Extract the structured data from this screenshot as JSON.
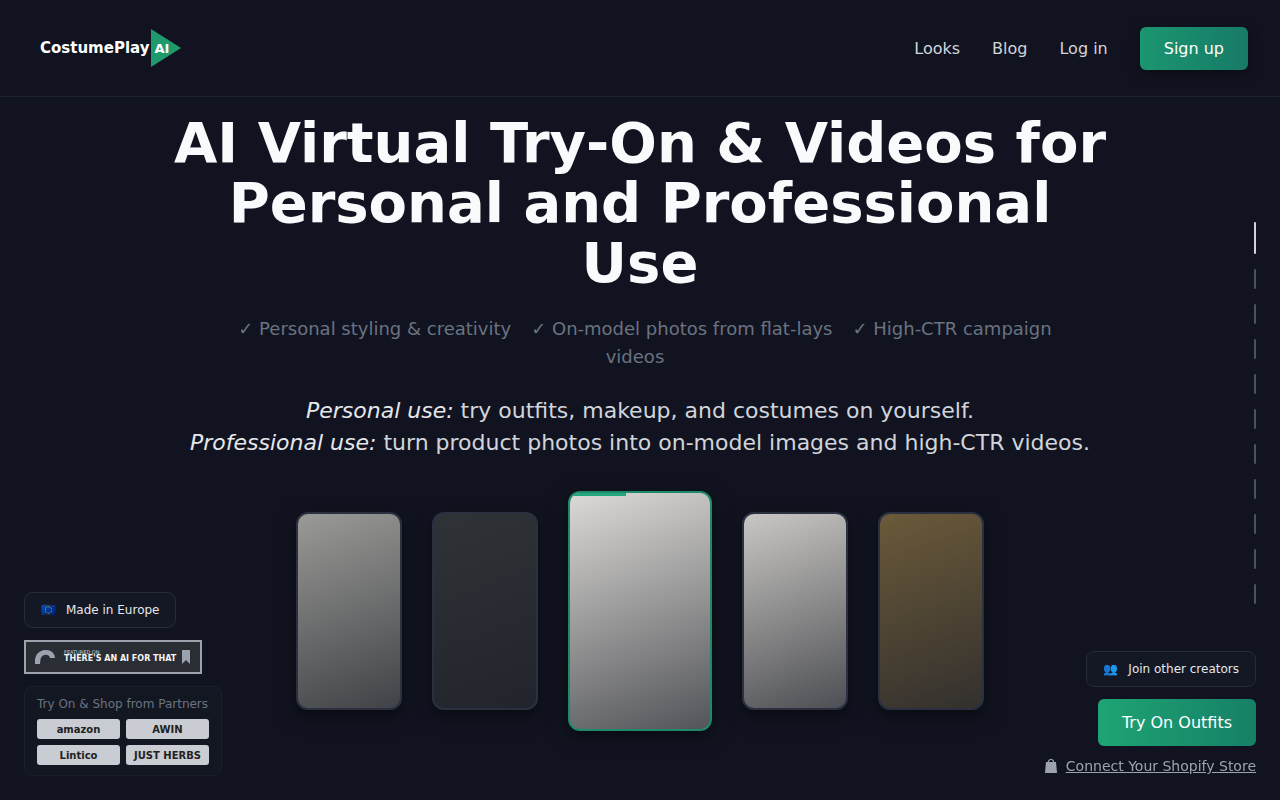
{
  "header": {
    "logo": {
      "name": "CostumePlay",
      "badge": "AI"
    },
    "nav": [
      {
        "label": "Looks"
      },
      {
        "label": "Blog"
      },
      {
        "label": "Log in"
      }
    ],
    "signup": "Sign up"
  },
  "hero": {
    "title_lines": [
      "AI Virtual Try-On & Videos for",
      "Personal and Professional",
      "Use"
    ],
    "features": [
      "✓ Personal styling & creativity",
      "✓ On-model photos from flat-lays",
      "✓ High-CTR campaign videos"
    ],
    "uses": [
      {
        "label": "Personal use:",
        "text": " try outfits, makeup, and costumes on yourself."
      },
      {
        "label": "Professional use:",
        "text": " turn product photos into on-model images and high-CTR videos."
      }
    ]
  },
  "gallery": [
    {
      "selected": false,
      "color": "#9a9a96"
    },
    {
      "selected": false,
      "color": "#2f3236"
    },
    {
      "selected": true,
      "color": "#dcdad6",
      "level": 0.4
    },
    {
      "selected": false,
      "color": "#c9c7c3"
    },
    {
      "selected": false,
      "color": "#6b5a3a"
    }
  ],
  "scroll_steps": [
    {
      "selected": true
    },
    {
      "selected": false
    },
    {
      "selected": false
    },
    {
      "selected": false
    },
    {
      "selected": false
    },
    {
      "selected": false
    },
    {
      "selected": false
    },
    {
      "selected": false
    },
    {
      "selected": false
    },
    {
      "selected": false
    },
    {
      "selected": false
    }
  ],
  "badges": {
    "europe": {
      "flag": "🇪🇺",
      "label": "Made in Europe"
    },
    "featured": {
      "small": "FEATURED ON",
      "big": "THERE'S AN AI FOR THAT"
    }
  },
  "partners": {
    "title": "Try On & Shop from Partners",
    "items": [
      "amazon",
      "AWIN",
      "Lintico",
      "JUST HERBS"
    ]
  },
  "cta": {
    "join": {
      "icon": "👥",
      "label": "Join other creators"
    },
    "try": "Try On Outfits",
    "shopify": "Connect Your Shopify Store"
  }
}
